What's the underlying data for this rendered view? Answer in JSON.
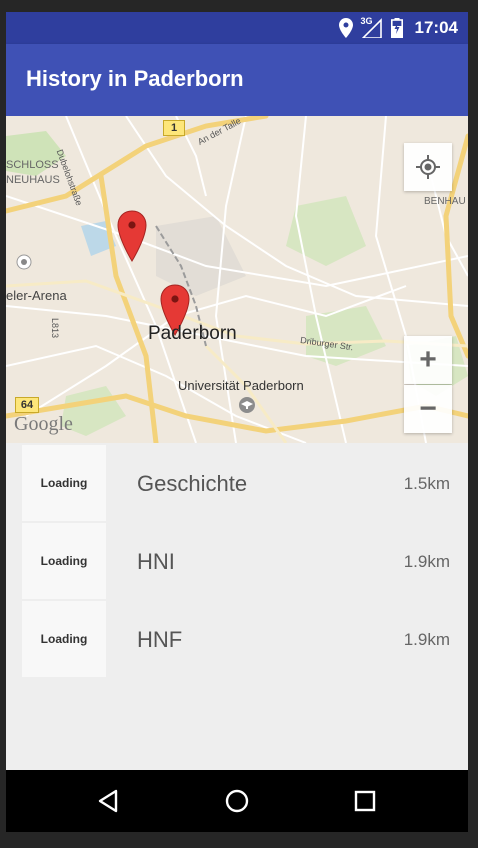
{
  "status_bar": {
    "network": "3G",
    "time": "17:04",
    "icons": [
      "location-icon",
      "signal-icon",
      "battery-charging-icon"
    ]
  },
  "app_bar": {
    "title": "History in Paderborn"
  },
  "map": {
    "labels": {
      "city": "Paderborn",
      "university": "Universität Paderborn",
      "schloss_1": "SCHLOSS",
      "schloss_2": "NEUHAUS",
      "arena": "eler-Arena",
      "benhausen": "BENHAU",
      "road_dubelohstrasse": "Dubelohstraße",
      "road_an_der_talle": "An der Talle",
      "road_driburger": "Driburger Str.",
      "road_l813": "L813",
      "shield_1": "1",
      "shield_64": "64",
      "attribution": "Google"
    },
    "controls": {
      "zoom_in": "+",
      "zoom_out": "−"
    },
    "icons": [
      "my-location-icon",
      "map-marker-icon",
      "university-icon"
    ]
  },
  "places": [
    {
      "thumb": "Loading",
      "name": "Geschichte",
      "distance": "1.5km"
    },
    {
      "thumb": "Loading",
      "name": "HNI",
      "distance": "1.9km"
    },
    {
      "thumb": "Loading",
      "name": "HNF",
      "distance": "1.9km"
    }
  ],
  "nav_bar": {
    "icons": [
      "back-icon",
      "home-icon",
      "recents-icon"
    ]
  }
}
